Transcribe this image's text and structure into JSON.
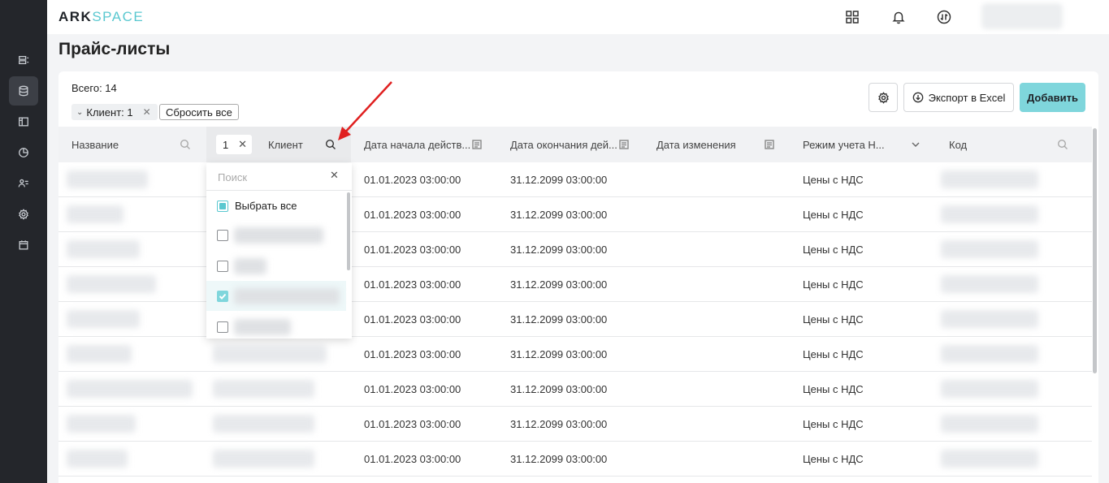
{
  "app": {
    "logo_part1": "ARK",
    "logo_part2": "SPACE"
  },
  "page": {
    "title": "Прайс-листы"
  },
  "toolbar": {
    "total_label": "Всего: 14",
    "filter_chip": "Клиент: 1",
    "reset_label": "Сбросить все",
    "export_label": "Экспорт в Excel",
    "add_label": "Добавить"
  },
  "table": {
    "columns": [
      "Название",
      "Клиент",
      "Дата начала действ...",
      "Дата окончания дей...",
      "Дата изменения",
      "Режим учета Н...",
      "Код"
    ],
    "client_filter_value": "1",
    "rows": [
      {
        "start": "01.01.2023 03:00:00",
        "end": "31.12.2099 03:00:00",
        "mode": "Цены с НДС"
      },
      {
        "start": "01.01.2023 03:00:00",
        "end": "31.12.2099 03:00:00",
        "mode": "Цены с НДС"
      },
      {
        "start": "01.01.2023 03:00:00",
        "end": "31.12.2099 03:00:00",
        "mode": "Цены с НДС"
      },
      {
        "start": "01.01.2023 03:00:00",
        "end": "31.12.2099 03:00:00",
        "mode": "Цены с НДС"
      },
      {
        "start": "01.01.2023 03:00:00",
        "end": "31.12.2099 03:00:00",
        "mode": "Цены с НДС"
      },
      {
        "start": "01.01.2023 03:00:00",
        "end": "31.12.2099 03:00:00",
        "mode": "Цены с НДС"
      },
      {
        "start": "01.01.2023 03:00:00",
        "end": "31.12.2099 03:00:00",
        "mode": "Цены с НДС"
      },
      {
        "start": "01.01.2023 03:00:00",
        "end": "31.12.2099 03:00:00",
        "mode": "Цены с НДС"
      },
      {
        "start": "01.01.2023 03:00:00",
        "end": "31.12.2099 03:00:00",
        "mode": "Цены с НДС"
      }
    ]
  },
  "client_dropdown": {
    "search_placeholder": "Поиск",
    "select_all_label": "Выбрать все",
    "items": [
      {
        "checked": false
      },
      {
        "checked": false
      },
      {
        "checked": true
      },
      {
        "checked": false
      }
    ]
  },
  "colors": {
    "accent": "#7fd6dc",
    "sidebar": "#24262b",
    "annotation_arrow": "#e02020"
  }
}
